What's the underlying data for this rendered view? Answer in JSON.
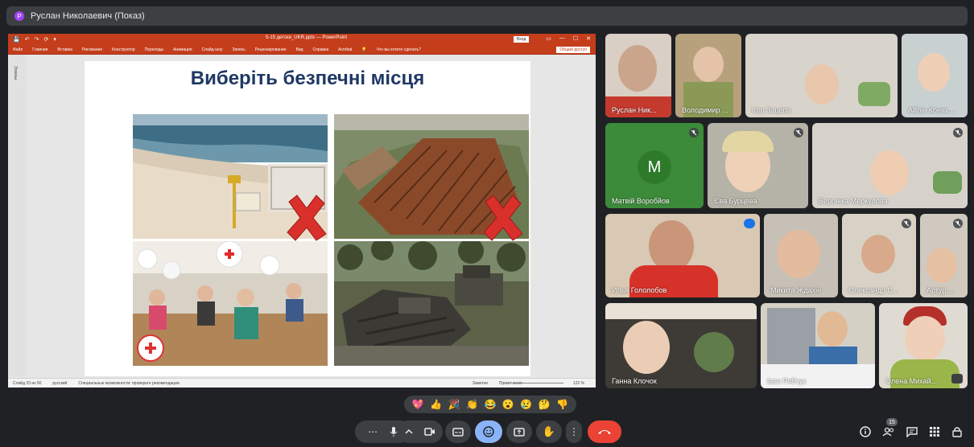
{
  "presenter": {
    "avatar_letter": "Р",
    "title": "Руслан Николаевич (Показ)"
  },
  "powerpoint": {
    "qat": [
      "💾",
      "↶",
      "↷",
      "⟳",
      "▾"
    ],
    "filename": "5-15 детски_UKR.pptx — PowerPoint",
    "signin": "Вход",
    "winbtns": [
      "▭",
      "—",
      "☐",
      "✕"
    ],
    "ribbon_tabs": [
      "Файл",
      "Главная",
      "Вставка",
      "Рисование",
      "Конструктор",
      "Переходы",
      "Анимация",
      "Слайд-шоу",
      "Запись",
      "Рецензирование",
      "Вид",
      "Справка",
      "Acrobat"
    ],
    "tell_me": "Что вы хотите сделать?",
    "share": "Общий доступ",
    "left_pane": "Эскизы",
    "status": {
      "slide": "Слайд 33 из 50",
      "lang": "русский",
      "accessibility": "Специальные возможности: проверьте рекомендации",
      "notes": "Заметки",
      "comments": "Примечания",
      "zoom": "122 %"
    },
    "slide_title": "Виберіть безпечні місця"
  },
  "participants": [
    {
      "name": "Руслан Ник...",
      "muted": false
    },
    {
      "name": "Володимир ...",
      "muted": false
    },
    {
      "name": "Ігор Зацепа",
      "muted": false
    },
    {
      "name": "Айлін Конях...",
      "muted": false
    },
    {
      "name": "Матвій Воробйов",
      "muted": true,
      "avatar_letter": "M"
    },
    {
      "name": "Єва Бурцева",
      "muted": true
    },
    {
      "name": "Вероніка Меркулова",
      "muted": true
    },
    {
      "name": "Илья Гололобов",
      "muted": false,
      "speaking": true
    },
    {
      "name": "Микита Ждахін",
      "muted": false
    },
    {
      "name": "Олександр С...",
      "muted": true
    },
    {
      "name": "Артур ...",
      "muted": true
    },
    {
      "name": "Ганна Клочок",
      "muted": false
    },
    {
      "name": "Іван Рябчук",
      "muted": false
    },
    {
      "name": "Олена Михай...",
      "muted": false
    }
  ],
  "reactions": [
    "💖",
    "👍",
    "🎉",
    "👏",
    "😂",
    "😮",
    "😢",
    "🤔",
    "👎"
  ],
  "controls": {
    "more": "⋯",
    "badge_count": "15"
  },
  "colors": {
    "ppt_accent": "#c43e1c",
    "meet_bg": "#202124",
    "end_call": "#ea4335",
    "reactions_active": "#8ab4f8"
  }
}
